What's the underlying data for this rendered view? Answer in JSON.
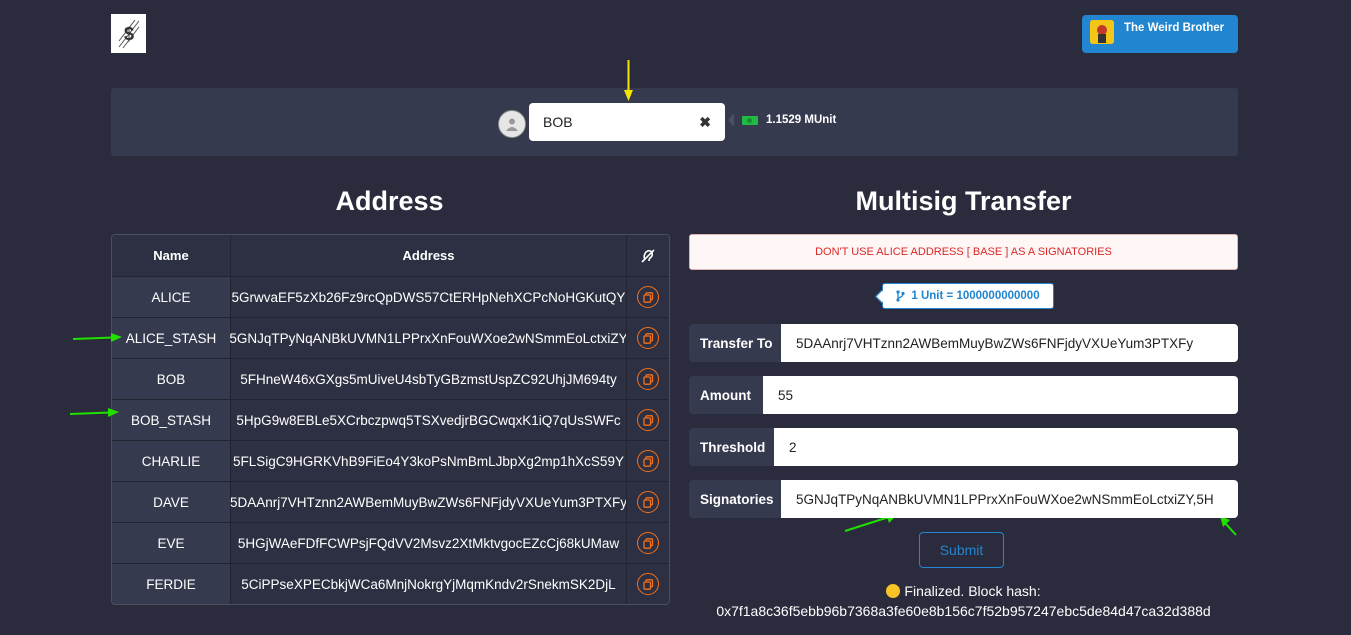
{
  "header": {
    "logo_icon": "dollar-logo-icon",
    "user_name": "The Weird Brother"
  },
  "account_bar": {
    "selected_account": "BOB",
    "clear_icon": "✖",
    "balance": "1.1529 MUnit"
  },
  "address_section": {
    "title": "Address",
    "columns": [
      "Name",
      "Address"
    ],
    "rows": [
      {
        "name": "ALICE",
        "address": "5GrwvaEF5zXb26Fz9rcQpDWS57CtERHpNehXCPcNoHGKutQY"
      },
      {
        "name": "ALICE_STASH",
        "address": "5GNJqTPyNqANBkUVMN1LPPrxXnFouWXoe2wNSmmEoLctxiZY"
      },
      {
        "name": "BOB",
        "address": "5FHneW46xGXgs5mUiveU4sbTyGBzmstUspZC92UhjJM694ty"
      },
      {
        "name": "BOB_STASH",
        "address": "5HpG9w8EBLe5XCrbczpwq5TSXvedjrBGCwqxK1iQ7qUsSWFc"
      },
      {
        "name": "CHARLIE",
        "address": "5FLSigC9HGRKVhB9FiEo4Y3koPsNmBmLJbpXg2mp1hXcS59Y"
      },
      {
        "name": "DAVE",
        "address": "5DAAnrj7VHTznn2AWBemMuyBwZWs6FNFjdyVXUeYum3PTXFy"
      },
      {
        "name": "EVE",
        "address": "5HGjWAeFDfFCWPsjFQdVV2Msvz2XtMktvgocEZcCj68kUMaw"
      },
      {
        "name": "FERDIE",
        "address": "5CiPPseXPECbkjWCa6MnjNokrgYjMqmKndv2rSnekmSK2DjL"
      }
    ]
  },
  "multisig": {
    "title": "Multisig Transfer",
    "warning": "DON'T USE ALICE ADDRESS [ BASE ] AS A SIGNATORIES",
    "unit_info": "1 Unit = 1000000000000",
    "fields": {
      "transfer_to_label": "Transfer To",
      "transfer_to_value": "5DAAnrj7VHTznn2AWBemMuyBwZWs6FNFjdyVXUeYum3PTXFy",
      "amount_label": "Amount",
      "amount_value": "55",
      "threshold_label": "Threshold",
      "threshold_value": "2",
      "signatories_label": "Signatories",
      "signatories_value": "5GNJqTPyNqANBkUVMN1LPPrxXnFouWXoe2wNSmmEoLctxiZY,5H"
    },
    "submit_label": "Submit",
    "status_line1": "Finalized. Block hash:",
    "status_line2": "0x7f1a8c36f5ebb96b7368a3fe60e8b156c7f52b957247ebc5de84d47ca32d388d"
  },
  "colors": {
    "background": "#2a2b3c",
    "panel": "#363a4f",
    "primary_blue": "#2185d0",
    "copy_orange": "#f2711c",
    "annotation_green": "#21e000",
    "annotation_yellow": "#f5e600"
  }
}
